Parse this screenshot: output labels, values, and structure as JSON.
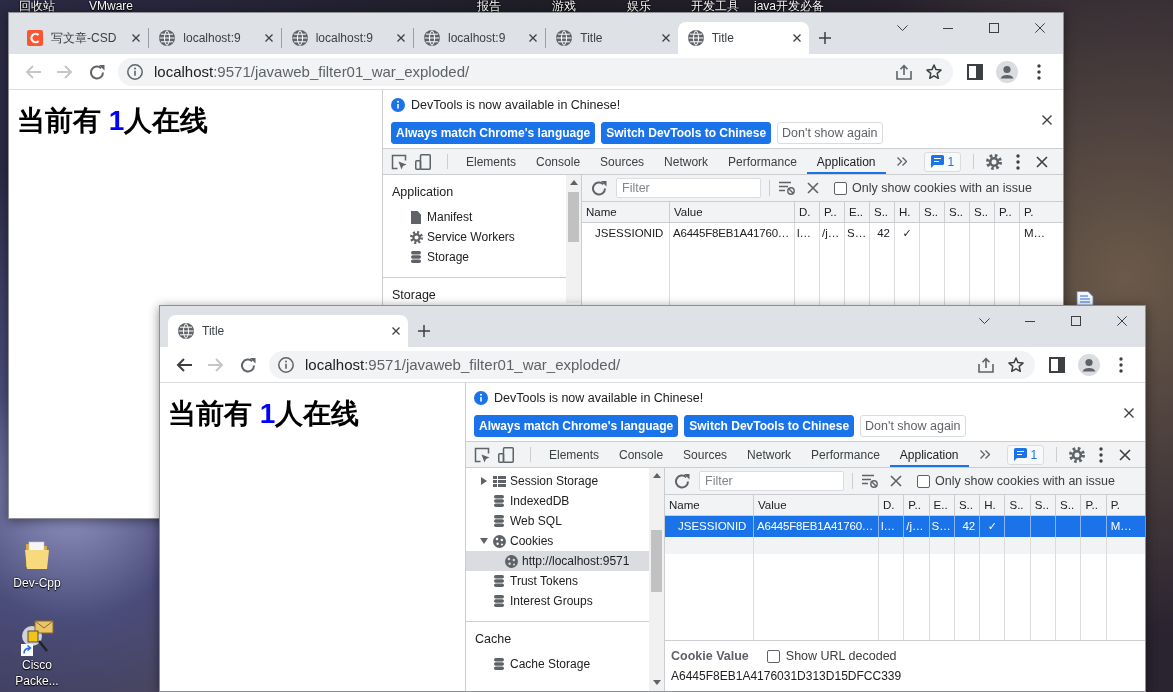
{
  "desktop": {
    "top_labels": [
      "回收站",
      "VMware",
      "报告",
      "游戏",
      "娱乐",
      "开发工具",
      "java开发必备"
    ],
    "icons": [
      {
        "label": "Dev-Cpp",
        "kind": "folder"
      },
      {
        "label": "Cisco Packe...",
        "kind": "program"
      },
      {
        "kind": "document"
      }
    ]
  },
  "windows": [
    {
      "tabs": [
        {
          "title": "写文章-CSD",
          "kind": "logo",
          "selected": false
        },
        {
          "title": "localhost:9",
          "kind": "page",
          "selected": false
        },
        {
          "title": "localhost:9",
          "kind": "page",
          "selected": false
        },
        {
          "title": "localhost:9",
          "kind": "page",
          "selected": false
        },
        {
          "title": "Title",
          "kind": "page",
          "selected": false
        },
        {
          "title": "Title",
          "kind": "page",
          "selected": true
        }
      ],
      "toolbar": {
        "back": {
          "disabled": true
        },
        "forward": {
          "disabled": true
        },
        "url": {
          "host": "localhost",
          "rest": ":9571/javaweb_filter01_war_exploded/"
        }
      },
      "page": {
        "heading": {
          "before": "当前有 ",
          "count": "1",
          "after": "人在线"
        }
      },
      "devtools": {
        "infobar": {
          "message": "DevTools is now available in Chinese!",
          "buttons": [
            {
              "label": "Always match Chrome's language",
              "kind": "primary"
            },
            {
              "label": "Switch DevTools to Chinese",
              "kind": "primary"
            },
            {
              "label": "Don't show again",
              "kind": "secondary"
            }
          ]
        },
        "tabs": [
          {
            "label": "Elements",
            "selected": false
          },
          {
            "label": "Console",
            "selected": false
          },
          {
            "label": "Sources",
            "selected": false
          },
          {
            "label": "Network",
            "selected": false
          },
          {
            "label": "Performance",
            "selected": false
          },
          {
            "label": "Application",
            "selected": true
          }
        ],
        "issues_count": "1",
        "sidebar": {
          "sections": [
            {
              "title": "Application",
              "items": [
                {
                  "label": "Manifest",
                  "kind": "file",
                  "selected": false
                },
                {
                  "label": "Service Workers",
                  "kind": "worker",
                  "selected": false
                },
                {
                  "label": "Storage",
                  "kind": "database",
                  "selected": false
                }
              ]
            },
            {
              "title": "Storage"
            }
          ]
        },
        "cookies": {
          "filter": {
            "placeholder": "Filter"
          },
          "issue_filter": {
            "label": "Only show cookies with an issue",
            "checked": false
          },
          "table": {
            "columns": [
              "Name",
              "Value",
              "D.",
              "P..",
              "E..",
              "S..",
              "H.",
              "S..",
              "S..",
              "S..",
              "P..",
              "P."
            ],
            "rows": [
              {
                "cells": [
                  "JSESSIONID",
                  "A6445F8EB1A41760…",
                  "l…",
                  "/j…",
                  "S…",
                  "42",
                  "✓",
                  null,
                  null,
                  null,
                  null,
                  "M…"
                ],
                "selected": false
              }
            ]
          }
        }
      }
    },
    {
      "tabs": [
        {
          "title": "Title",
          "kind": "page",
          "selected": true
        }
      ],
      "toolbar": {
        "back": {
          "disabled": false
        },
        "forward": {
          "disabled": true
        },
        "url": {
          "host": "localhost",
          "rest": ":9571/javaweb_filter01_war_exploded/"
        }
      },
      "page": {
        "heading": {
          "before": "当前有 ",
          "count": "1",
          "after": "人在线"
        }
      },
      "devtools": {
        "infobar": {
          "message": "DevTools is now available in Chinese!",
          "buttons": [
            {
              "label": "Always match Chrome's language",
              "kind": "primary"
            },
            {
              "label": "Switch DevTools to Chinese",
              "kind": "primary"
            },
            {
              "label": "Don't show again",
              "kind": "secondary"
            }
          ]
        },
        "tabs": [
          {
            "label": "Elements",
            "selected": false
          },
          {
            "label": "Console",
            "selected": false
          },
          {
            "label": "Sources",
            "selected": false
          },
          {
            "label": "Network",
            "selected": false
          },
          {
            "label": "Performance",
            "selected": false
          },
          {
            "label": "Application",
            "selected": true
          }
        ],
        "issues_count": "1",
        "sidebar": {
          "sections": [
            {
              "items": [
                {
                  "label": "Session Storage",
                  "kind": "table",
                  "expanded": false,
                  "selected": false
                },
                {
                  "label": "IndexedDB",
                  "kind": "database",
                  "selected": false
                },
                {
                  "label": "Web SQL",
                  "kind": "database",
                  "selected": false
                },
                {
                  "label": "Cookies",
                  "kind": "cookies",
                  "expanded": true,
                  "selected": false,
                  "children": [
                    {
                      "label": "http://localhost:9571",
                      "kind": "origin",
                      "selected": true
                    }
                  ]
                },
                {
                  "label": "Trust Tokens",
                  "kind": "database",
                  "selected": false
                },
                {
                  "label": "Interest Groups",
                  "kind": "database",
                  "selected": false
                }
              ]
            },
            {
              "title": "Cache",
              "items": [
                {
                  "label": "Cache Storage",
                  "kind": "database",
                  "selected": false
                }
              ]
            }
          ]
        },
        "cookies": {
          "filter": {
            "placeholder": "Filter"
          },
          "issue_filter": {
            "label": "Only show cookies with an issue",
            "checked": false
          },
          "table": {
            "columns": [
              "Name",
              "Value",
              "D.",
              "P..",
              "E..",
              "S..",
              "H.",
              "S..",
              "S..",
              "S..",
              "P..",
              "P."
            ],
            "rows": [
              {
                "cells": [
                  "JSESSIONID",
                  "A6445F8EB1A41760…",
                  "l…",
                  "/j…",
                  "S…",
                  "42",
                  "✓",
                  null,
                  null,
                  null,
                  null,
                  "M…"
                ],
                "selected": true
              }
            ]
          },
          "cookie_value": {
            "title": "Cookie Value",
            "decode": {
              "label": "Show URL decoded",
              "checked": false
            },
            "value": "A6445F8EB1A4176031D313D15DFCC339"
          }
        }
      }
    }
  ]
}
